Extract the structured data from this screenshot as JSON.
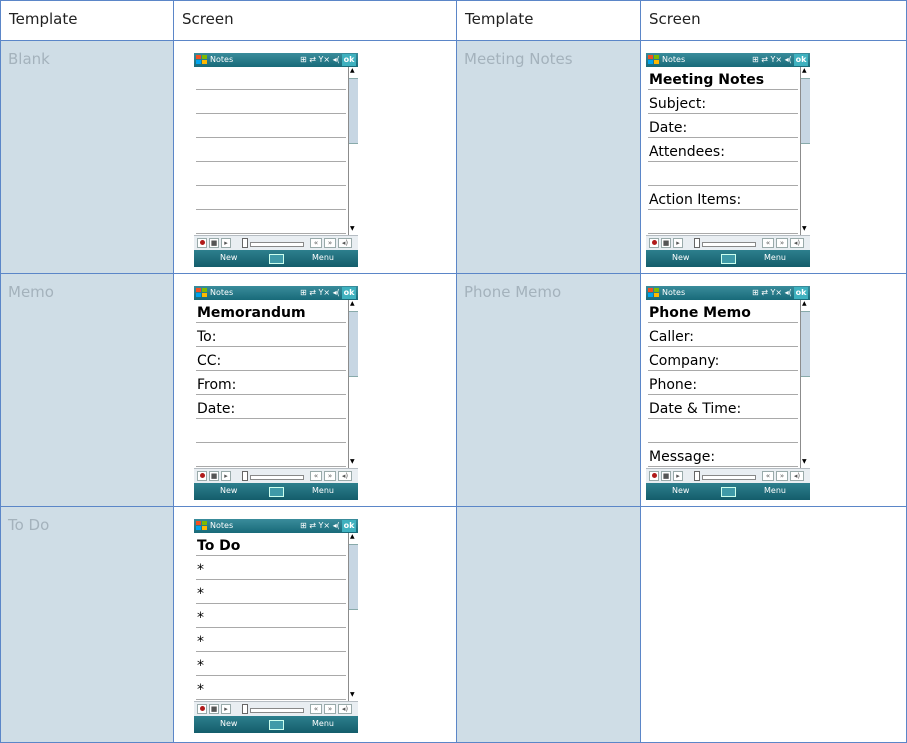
{
  "headers": {
    "template_left": "Template",
    "screen_left": "Screen",
    "template_right": "Template",
    "screen_right": "Screen"
  },
  "rows": [
    {
      "left_name": "Blank",
      "right_name": "Meeting Notes"
    },
    {
      "left_name": "Memo",
      "right_name": "Phone Memo"
    },
    {
      "left_name": "To Do",
      "right_name": ""
    }
  ],
  "device": {
    "app_title": "Notes",
    "ok_label": "ok",
    "new_label": "New",
    "menu_label": "Menu",
    "status_icons": "⊞ ⇄ Y× ◂("
  },
  "screens": {
    "meeting_notes": {
      "title": "Meeting Notes",
      "lines": [
        "Subject:",
        "Date:",
        "Attendees:",
        "",
        "Action Items:"
      ]
    },
    "memo": {
      "title": "Memorandum",
      "lines": [
        "To:",
        "CC:",
        "From:",
        "Date:"
      ]
    },
    "phone_memo": {
      "title": "Phone Memo",
      "lines": [
        "Caller:",
        "Company:",
        "Phone:",
        "Date & Time:",
        "",
        "Message:"
      ]
    },
    "todo": {
      "title": "To Do",
      "lines": [
        "*",
        "*",
        "*",
        "*",
        "*",
        "*"
      ]
    }
  },
  "colors": {
    "border": "#5b86c8",
    "template_cell_bg": "#cfdde6",
    "template_text": "#a4b2bc",
    "titlebar": "#1f7585"
  }
}
